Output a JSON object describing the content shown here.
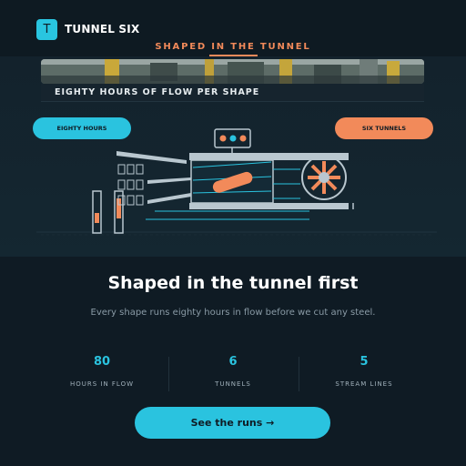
{
  "brand": {
    "badge_letter": "T",
    "name": "TUNNEL SIX"
  },
  "hero": {
    "tag": "SHAPED IN THE TUNNEL",
    "caption": "EIGHTY HOURS OF FLOW PER SHAPE",
    "left_pill": "EIGHTY HOURS",
    "right_pill": "SIX TUNNELS"
  },
  "main": {
    "headline": "Shaped in the tunnel first",
    "subhead": "Every shape runs eighty hours in flow before we cut any steel."
  },
  "stats": [
    {
      "value": "80",
      "label": "HOURS IN FLOW"
    },
    {
      "value": "6",
      "label": "TUNNELS"
    },
    {
      "value": "5",
      "label": "STREAM LINES"
    }
  ],
  "cta": {
    "label": "See the runs →"
  },
  "colors": {
    "accent_cyan": "#2ac3df",
    "accent_orange": "#f28a5a",
    "background": "#0f1b24"
  },
  "icons": {
    "diagram": "wind-tunnel-diagram",
    "fan": "fan-icon"
  }
}
